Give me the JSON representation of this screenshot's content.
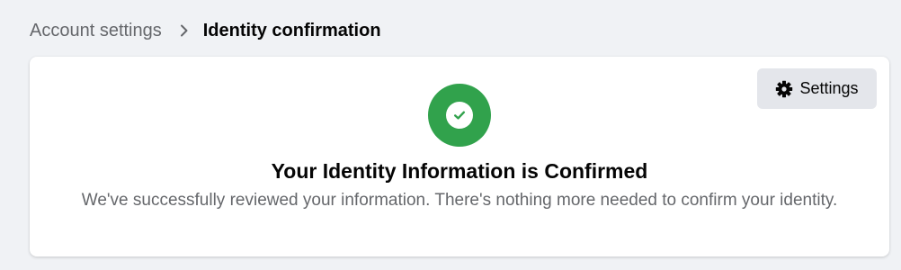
{
  "breadcrumb": {
    "parent": "Account settings",
    "separator_icon": "chevron-right-icon",
    "current": "Identity confirmation"
  },
  "card": {
    "settings_button": {
      "icon": "gear-icon",
      "label": "Settings"
    },
    "status_icon": "check-circle-icon",
    "title": "Your Identity Information is Confirmed",
    "description": "We've successfully reviewed your information. There's nothing more needed to confirm your identity."
  },
  "colors": {
    "background": "#f0f2f5",
    "card": "#ffffff",
    "success_green": "#31a24c",
    "secondary_button": "#e4e6eb",
    "primary_text": "#050505",
    "secondary_text": "#65676b"
  }
}
